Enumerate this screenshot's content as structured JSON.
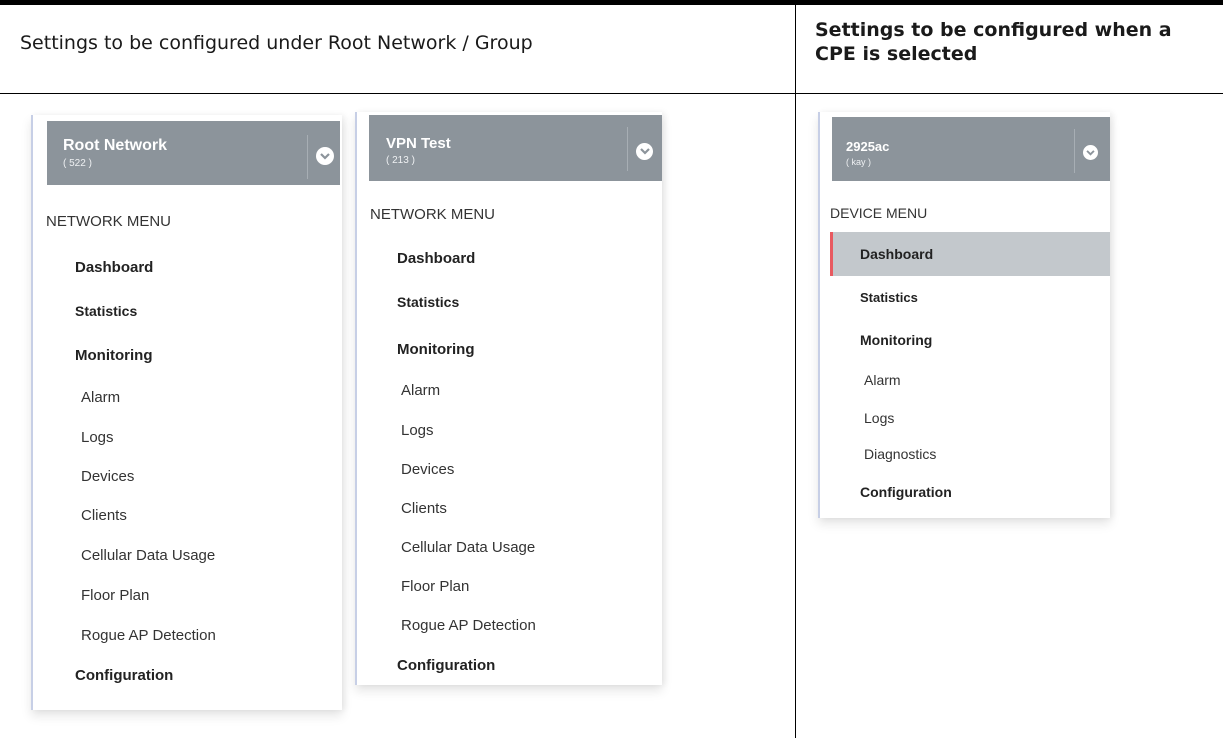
{
  "headers": {
    "left": "Settings to be configured under Root Network / Group",
    "right": "Settings to be configured when a CPE is selected"
  },
  "panels": [
    {
      "network_name": "Root Network",
      "network_sub": "( 522 )",
      "menu_title": "NETWORK MENU",
      "items": [
        {
          "label": "Dashboard"
        },
        {
          "label": "Statistics"
        },
        {
          "label": "Monitoring"
        },
        {
          "label": "Alarm"
        },
        {
          "label": "Logs"
        },
        {
          "label": "Devices"
        },
        {
          "label": "Clients"
        },
        {
          "label": "Cellular Data Usage"
        },
        {
          "label": "Floor Plan"
        },
        {
          "label": "Rogue AP Detection"
        },
        {
          "label": "Configuration"
        }
      ]
    },
    {
      "network_name": "VPN Test",
      "network_sub": "( 213 )",
      "menu_title": "NETWORK MENU",
      "items": [
        {
          "label": "Dashboard"
        },
        {
          "label": "Statistics"
        },
        {
          "label": "Monitoring"
        },
        {
          "label": "Alarm"
        },
        {
          "label": "Logs"
        },
        {
          "label": "Devices"
        },
        {
          "label": "Clients"
        },
        {
          "label": "Cellular Data Usage"
        },
        {
          "label": "Floor Plan"
        },
        {
          "label": "Rogue AP Detection"
        },
        {
          "label": "Configuration"
        }
      ]
    },
    {
      "network_name": "2925ac",
      "network_sub": "( kay )",
      "menu_title": "DEVICE MENU",
      "items": [
        {
          "label": "Dashboard"
        },
        {
          "label": "Statistics"
        },
        {
          "label": "Monitoring"
        },
        {
          "label": "Alarm"
        },
        {
          "label": "Logs"
        },
        {
          "label": "Diagnostics"
        },
        {
          "label": "Configuration"
        }
      ]
    }
  ],
  "icons": {
    "toggle": "chevron-down-circle-icon"
  },
  "colors": {
    "header_bg": "#8c949b",
    "active_row": "#c3c8cc",
    "active_marker": "#e85a60"
  }
}
